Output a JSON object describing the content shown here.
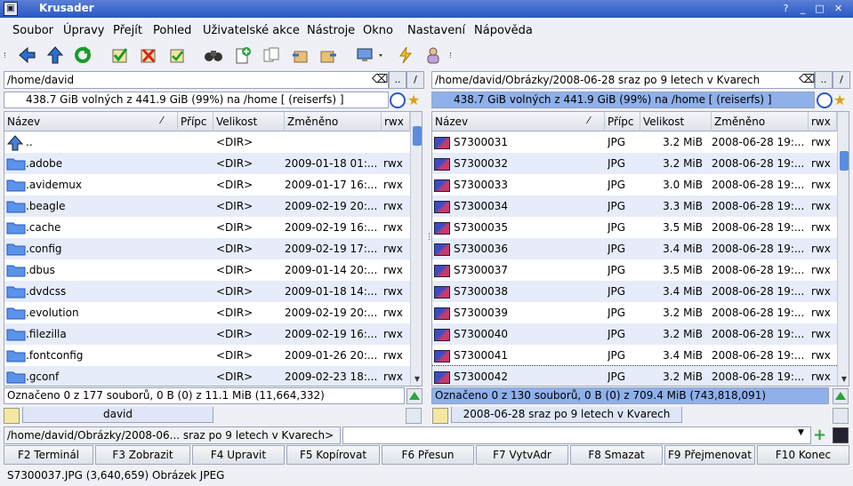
{
  "window": {
    "title": "Krusader"
  },
  "menu": [
    "Soubor",
    "Úpravy",
    "Přejít",
    "Pohled",
    "Uživatelské akce",
    "Nástroje",
    "Okno",
    "Nastavení",
    "Nápověda"
  ],
  "left": {
    "path": "/home/david",
    "free": "438.7 GiB volných z 441.9 GiB (99%) na /home [ (reiserfs) ]",
    "columns": [
      "Název",
      "Přípc",
      "Velikost",
      "Změněno",
      "rwx"
    ],
    "rows": [
      {
        "name": "..",
        "ext": "",
        "size": "<DIR>",
        "date": "",
        "perm": "",
        "icon": "up-arrow-icon"
      },
      {
        "name": ".adobe",
        "ext": "",
        "size": "<DIR>",
        "date": "2009-01-18 01:...",
        "perm": "rwx",
        "icon": "folder-icon"
      },
      {
        "name": ".avidemux",
        "ext": "",
        "size": "<DIR>",
        "date": "2009-01-17 16:...",
        "perm": "rwx",
        "icon": "folder-icon"
      },
      {
        "name": ".beagle",
        "ext": "",
        "size": "<DIR>",
        "date": "2009-02-19 20:...",
        "perm": "rwx",
        "icon": "folder-icon"
      },
      {
        "name": ".cache",
        "ext": "",
        "size": "<DIR>",
        "date": "2009-02-19 16:...",
        "perm": "rwx",
        "icon": "folder-icon"
      },
      {
        "name": ".config",
        "ext": "",
        "size": "<DIR>",
        "date": "2009-02-19 17:...",
        "perm": "rwx",
        "icon": "folder-icon"
      },
      {
        "name": ".dbus",
        "ext": "",
        "size": "<DIR>",
        "date": "2009-01-14 20:...",
        "perm": "rwx",
        "icon": "folder-icon"
      },
      {
        "name": ".dvdcss",
        "ext": "",
        "size": "<DIR>",
        "date": "2009-01-18 14:...",
        "perm": "rwx",
        "icon": "folder-icon"
      },
      {
        "name": ".evolution",
        "ext": "",
        "size": "<DIR>",
        "date": "2009-02-19 20:...",
        "perm": "rwx",
        "icon": "folder-icon"
      },
      {
        "name": ".filezilla",
        "ext": "",
        "size": "<DIR>",
        "date": "2009-02-19 16:...",
        "perm": "rwx",
        "icon": "folder-icon"
      },
      {
        "name": ".fontconfig",
        "ext": "",
        "size": "<DIR>",
        "date": "2009-01-26 20:...",
        "perm": "rwx",
        "icon": "folder-icon"
      },
      {
        "name": ".gconf",
        "ext": "",
        "size": "<DIR>",
        "date": "2009-02-23 18:...",
        "perm": "rwx",
        "icon": "folder-icon"
      }
    ],
    "status": "Označeno 0 z 177 souborů, 0 B  (0) z 11.1 MiB (11,664,332)",
    "tab": "david"
  },
  "right": {
    "path": "/home/david/Obrázky/2008-06-28 sraz po 9 letech v Kvarech",
    "free": "438.7 GiB volných z 441.9 GiB (99%) na /home [ (reiserfs) ]",
    "columns": [
      "Název",
      "Přípc",
      "Velikost",
      "Změněno",
      "rwx"
    ],
    "rows": [
      {
        "name": "S7300031",
        "ext": "JPG",
        "size": "3.2 MiB",
        "date": "2008-06-28 19:...",
        "perm": "rwx"
      },
      {
        "name": "S7300032",
        "ext": "JPG",
        "size": "3.2 MiB",
        "date": "2008-06-28 19:...",
        "perm": "rwx"
      },
      {
        "name": "S7300033",
        "ext": "JPG",
        "size": "3.0 MiB",
        "date": "2008-06-28 19:...",
        "perm": "rwx"
      },
      {
        "name": "S7300034",
        "ext": "JPG",
        "size": "3.3 MiB",
        "date": "2008-06-28 19:...",
        "perm": "rwx"
      },
      {
        "name": "S7300035",
        "ext": "JPG",
        "size": "3.5 MiB",
        "date": "2008-06-28 19:...",
        "perm": "rwx"
      },
      {
        "name": "S7300036",
        "ext": "JPG",
        "size": "3.4 MiB",
        "date": "2008-06-28 19:...",
        "perm": "rwx"
      },
      {
        "name": "S7300037",
        "ext": "JPG",
        "size": "3.5 MiB",
        "date": "2008-06-28 19:...",
        "perm": "rwx"
      },
      {
        "name": "S7300038",
        "ext": "JPG",
        "size": "3.4 MiB",
        "date": "2008-06-28 19:...",
        "perm": "rwx"
      },
      {
        "name": "S7300039",
        "ext": "JPG",
        "size": "3.2 MiB",
        "date": "2008-06-28 19:...",
        "perm": "rwx"
      },
      {
        "name": "S7300040",
        "ext": "JPG",
        "size": "3.2 MiB",
        "date": "2008-06-28 19:...",
        "perm": "rwx"
      },
      {
        "name": "S7300041",
        "ext": "JPG",
        "size": "3.4 MiB",
        "date": "2008-06-28 19:...",
        "perm": "rwx"
      },
      {
        "name": "S7300042",
        "ext": "JPG",
        "size": "3.2 MiB",
        "date": "2008-06-28 19:...",
        "perm": "rwx"
      }
    ],
    "status": "Označeno 0 z 130 souborů, 0 B  (0) z 709.4 MiB (743,818,091)",
    "tab": "2008-06-28 sraz po 9 letech v Kvarech"
  },
  "cmdline": {
    "prompt": "/home/david/Obrázky/2008-06... sraz po 9 letech v Kvarech>",
    "value": ""
  },
  "fkeys": [
    "F2 Terminál",
    "F3 Zobrazit",
    "F4 Upravit",
    "F5 Kopírovat",
    "F6 Přesun",
    "F7 VytvAdr",
    "F8 Smazat",
    "F9 Přejmenovat",
    "F10 Konec"
  ],
  "statusbar": "S7300037.JPG (3,640,659)  Obrázek JPEG",
  "colors": {
    "selection": "#8fb0ea",
    "row_alt": "#e6ecfa",
    "title_bg": "#2a58c4"
  }
}
